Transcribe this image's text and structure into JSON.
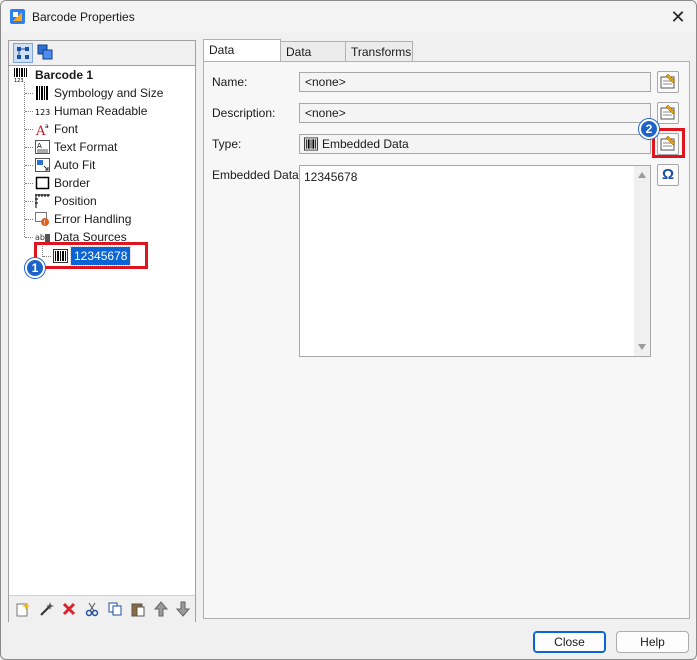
{
  "window": {
    "title": "Barcode Properties"
  },
  "tree": {
    "root": "Barcode 1",
    "items": [
      {
        "label": "Symbology and Size",
        "icon": "barcode-icon"
      },
      {
        "label": "Human Readable",
        "icon": "numbers-icon"
      },
      {
        "label": "Font",
        "icon": "font-icon"
      },
      {
        "label": "Text Format",
        "icon": "text-format-icon"
      },
      {
        "label": "Auto Fit",
        "icon": "auto-fit-icon"
      },
      {
        "label": "Border",
        "icon": "border-icon"
      },
      {
        "label": "Position",
        "icon": "position-icon"
      },
      {
        "label": "Error Handling",
        "icon": "error-handling-icon"
      },
      {
        "label": "Data Sources",
        "icon": "data-sources-icon"
      }
    ],
    "selected_child": "12345678"
  },
  "tabs": [
    "Data Source",
    "Data Type",
    "Transforms"
  ],
  "form": {
    "name_label": "Name:",
    "name_value": "<none>",
    "description_label": "Description:",
    "description_value": "<none>",
    "type_label": "Type:",
    "type_value": "Embedded Data",
    "embedded_label": "Embedded Data:",
    "embedded_value": "12345678",
    "omega_symbol": "Ω"
  },
  "annotations": {
    "badge1": "1",
    "badge2": "2"
  },
  "buttons": {
    "close": "Close",
    "help": "Help"
  },
  "colors": {
    "accent": "#0a64d6",
    "annotation_red": "#e0141e",
    "badge_blue": "#1d63c8"
  }
}
